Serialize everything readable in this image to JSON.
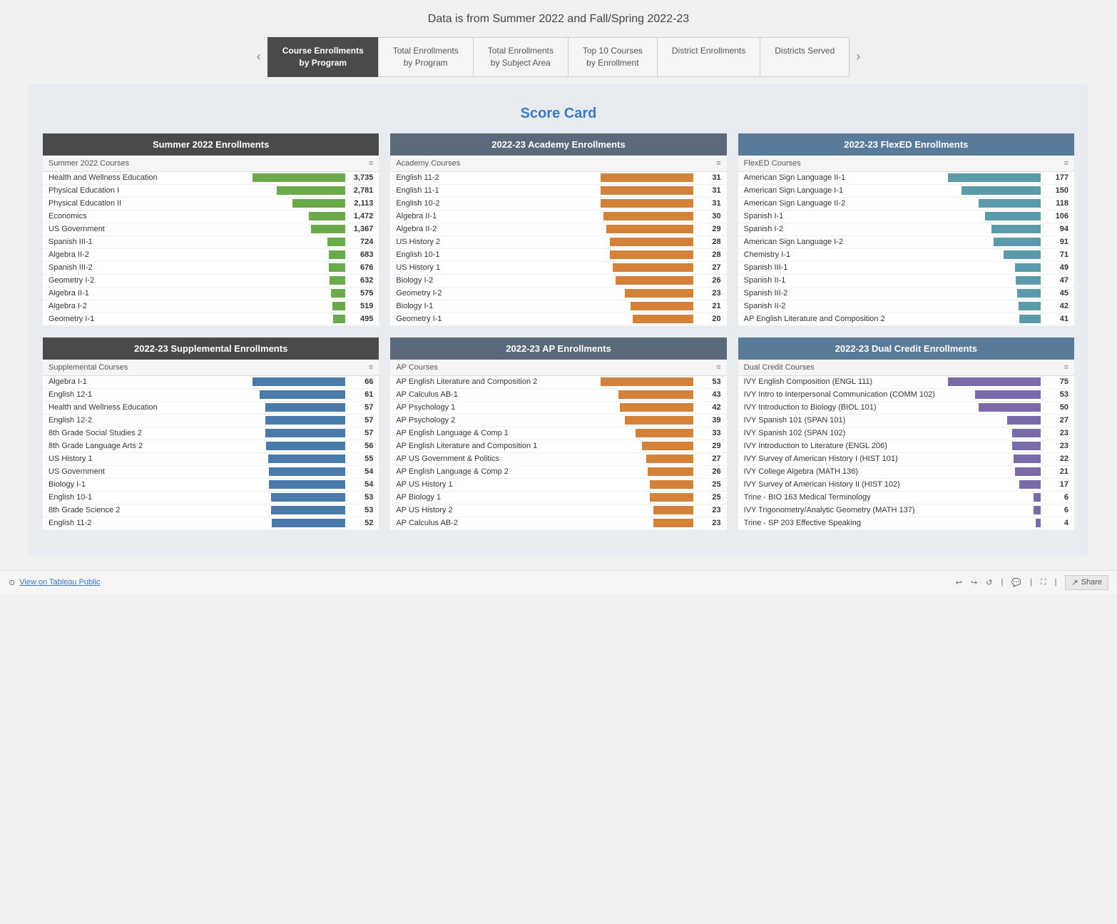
{
  "page": {
    "title": "Data is from Summer 2022 and Fall/Spring 2022-23",
    "score_card_label": "Score Card"
  },
  "nav": {
    "prev_arrow": "‹",
    "next_arrow": "›",
    "tabs": [
      {
        "label": "Course Enrollments\nby Program",
        "active": true
      },
      {
        "label": "Total Enrollments\nby Program",
        "active": false
      },
      {
        "label": "Total Enrollments\nby Subject Area",
        "active": false
      },
      {
        "label": "Top 10 Courses\nby Enrollment",
        "active": false
      },
      {
        "label": "District Enrollments",
        "active": false
      },
      {
        "label": "Districts Served",
        "active": false
      }
    ]
  },
  "summer2022": {
    "header": "Summer 2022 Enrollments",
    "subheader": "Summer 2022 Courses",
    "rows": [
      {
        "label": "Health and Wellness Education",
        "value": "3,735",
        "bar": 100
      },
      {
        "label": "Physical Education I",
        "value": "2,781",
        "bar": 74
      },
      {
        "label": "Physical Education II",
        "value": "2,113",
        "bar": 57
      },
      {
        "label": "Economics",
        "value": "1,472",
        "bar": 39
      },
      {
        "label": "US Government",
        "value": "1,367",
        "bar": 37
      },
      {
        "label": "Spanish III-1",
        "value": "724",
        "bar": 19
      },
      {
        "label": "Algebra II-2",
        "value": "683",
        "bar": 18
      },
      {
        "label": "Spanish III-2",
        "value": "676",
        "bar": 18
      },
      {
        "label": "Geometry I-2",
        "value": "632",
        "bar": 17
      },
      {
        "label": "Algebra II-1",
        "value": "575",
        "bar": 15
      },
      {
        "label": "Algebra I-2",
        "value": "519",
        "bar": 14
      },
      {
        "label": "Geometry I-1",
        "value": "495",
        "bar": 13
      }
    ]
  },
  "academy": {
    "header": "2022-23 Academy Enrollments",
    "subheader": "Academy Courses",
    "rows": [
      {
        "label": "English 11-2",
        "value": "31",
        "bar": 100
      },
      {
        "label": "English 11-1",
        "value": "31",
        "bar": 100
      },
      {
        "label": "English 10-2",
        "value": "31",
        "bar": 100
      },
      {
        "label": "Algebra II-1",
        "value": "30",
        "bar": 97
      },
      {
        "label": "Algebra II-2",
        "value": "29",
        "bar": 94
      },
      {
        "label": "US History 2",
        "value": "28",
        "bar": 90
      },
      {
        "label": "English 10-1",
        "value": "28",
        "bar": 90
      },
      {
        "label": "US History 1",
        "value": "27",
        "bar": 87
      },
      {
        "label": "Biology I-2",
        "value": "26",
        "bar": 84
      },
      {
        "label": "Geometry I-2",
        "value": "23",
        "bar": 74
      },
      {
        "label": "Biology I-1",
        "value": "21",
        "bar": 68
      },
      {
        "label": "Geometry I-1",
        "value": "20",
        "bar": 65
      }
    ]
  },
  "flexed": {
    "header": "2022-23 FlexED Enrollments",
    "subheader": "FlexED Courses",
    "rows": [
      {
        "label": "American Sign Language II-1",
        "value": "177",
        "bar": 100
      },
      {
        "label": "American Sign Language I-1",
        "value": "150",
        "bar": 85
      },
      {
        "label": "American Sign Language II-2",
        "value": "118",
        "bar": 67
      },
      {
        "label": "Spanish I-1",
        "value": "106",
        "bar": 60
      },
      {
        "label": "Spanish I-2",
        "value": "94",
        "bar": 53
      },
      {
        "label": "American Sign Language I-2",
        "value": "91",
        "bar": 51
      },
      {
        "label": "Chemistry I-1",
        "value": "71",
        "bar": 40
      },
      {
        "label": "Spanish III-1",
        "value": "49",
        "bar": 28
      },
      {
        "label": "Spanish II-1",
        "value": "47",
        "bar": 27
      },
      {
        "label": "Spanish III-2",
        "value": "45",
        "bar": 25
      },
      {
        "label": "Spanish II-2",
        "value": "42",
        "bar": 24
      },
      {
        "label": "AP English Literature and Composition 2",
        "value": "41",
        "bar": 23
      }
    ]
  },
  "supplemental": {
    "header": "2022-23 Supplemental Enrollments",
    "subheader": "Supplemental Courses",
    "rows": [
      {
        "label": "Algebra I-1",
        "value": "66",
        "bar": 100
      },
      {
        "label": "English 12-1",
        "value": "61",
        "bar": 92
      },
      {
        "label": "Health and Wellness Education",
        "value": "57",
        "bar": 86
      },
      {
        "label": "English 12-2",
        "value": "57",
        "bar": 86
      },
      {
        "label": "8th Grade Social Studies 2",
        "value": "57",
        "bar": 86
      },
      {
        "label": "8th Grade Language Arts 2",
        "value": "56",
        "bar": 85
      },
      {
        "label": "US History 1",
        "value": "55",
        "bar": 83
      },
      {
        "label": "US Government",
        "value": "54",
        "bar": 82
      },
      {
        "label": "Biology I-1",
        "value": "54",
        "bar": 82
      },
      {
        "label": "English 10-1",
        "value": "53",
        "bar": 80
      },
      {
        "label": "8th Grade Science 2",
        "value": "53",
        "bar": 80
      },
      {
        "label": "English 11-2",
        "value": "52",
        "bar": 79
      }
    ]
  },
  "ap": {
    "header": "2022-23 AP Enrollments",
    "subheader": "AP Courses",
    "rows": [
      {
        "label": "AP English Literature and Composition 2",
        "value": "53",
        "bar": 100
      },
      {
        "label": "AP Calculus AB-1",
        "value": "43",
        "bar": 81
      },
      {
        "label": "AP Psychology 1",
        "value": "42",
        "bar": 79
      },
      {
        "label": "AP Psychology 2",
        "value": "39",
        "bar": 74
      },
      {
        "label": "AP English Language & Comp 1",
        "value": "33",
        "bar": 62
      },
      {
        "label": "AP English Literature and Composition 1",
        "value": "29",
        "bar": 55
      },
      {
        "label": "AP US Government & Politics",
        "value": "27",
        "bar": 51
      },
      {
        "label": "AP English Language & Comp 2",
        "value": "26",
        "bar": 49
      },
      {
        "label": "AP US History 1",
        "value": "25",
        "bar": 47
      },
      {
        "label": "AP Biology 1",
        "value": "25",
        "bar": 47
      },
      {
        "label": "AP US History 2",
        "value": "23",
        "bar": 43
      },
      {
        "label": "AP Calculus AB-2",
        "value": "23",
        "bar": 43
      }
    ]
  },
  "dualcredit": {
    "header": "2022-23 Dual Credit Enrollments",
    "subheader": "Dual Credit Courses",
    "rows": [
      {
        "label": "IVY English Composition (ENGL 111)",
        "value": "75",
        "bar": 100
      },
      {
        "label": "IVY Intro to Interpersonal Communication (COMM 102)",
        "value": "53",
        "bar": 71
      },
      {
        "label": "IVY Introduction to Biology (BIOL 101)",
        "value": "50",
        "bar": 67
      },
      {
        "label": "IVY Spanish 101 (SPAN 101)",
        "value": "27",
        "bar": 36
      },
      {
        "label": "IVY Spanish 102 (SPAN 102)",
        "value": "23",
        "bar": 31
      },
      {
        "label": "IVY Introduction to Literature (ENGL 206)",
        "value": "23",
        "bar": 31
      },
      {
        "label": "IVY Survey of American History I (HIST 101)",
        "value": "22",
        "bar": 29
      },
      {
        "label": "IVY College Algebra (MATH 136)",
        "value": "21",
        "bar": 28
      },
      {
        "label": "IVY Survey of American History II (HIST 102)",
        "value": "17",
        "bar": 23
      },
      {
        "label": "Trine - BIO 163 Medical Terminology",
        "value": "6",
        "bar": 8
      },
      {
        "label": "IVY Trigonometry/Analytic Geometry (MATH 137)",
        "value": "6",
        "bar": 8
      },
      {
        "label": "Trine - SP 203 Effective Speaking",
        "value": "4",
        "bar": 5
      }
    ]
  },
  "footer": {
    "view_label": "View on Tableau Public",
    "share_label": "Share"
  }
}
